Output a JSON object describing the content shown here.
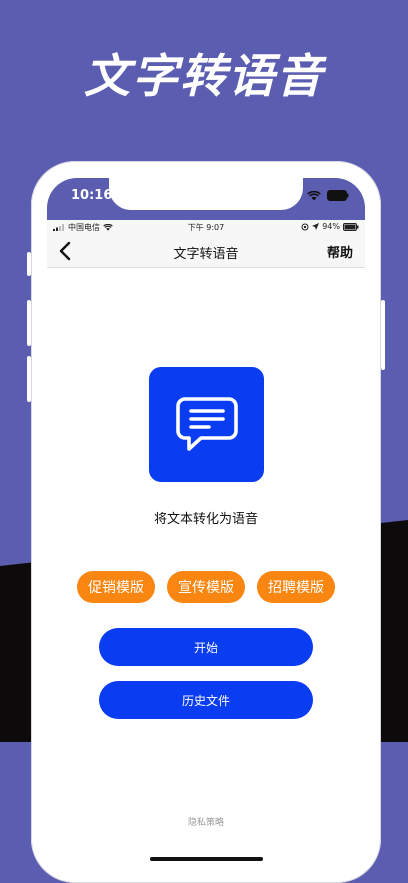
{
  "colors": {
    "background": "#5b5db0",
    "dark_band": "#0d0a0c",
    "accent_blue": "#0a3cf2",
    "template_orange": "#f98610"
  },
  "headline": "文字转语音",
  "outer_status": {
    "time": "10:16"
  },
  "inner_status": {
    "carrier": "中国电信",
    "time": "下午 9:07",
    "battery": "94%"
  },
  "navbar": {
    "back_icon": "chevron-left-icon",
    "title": "文字转语音",
    "help": "帮助"
  },
  "main": {
    "icon": "message-bubble-icon",
    "description": "将文本转化为语音",
    "templates": [
      {
        "label": "促销模版"
      },
      {
        "label": "宣传模版"
      },
      {
        "label": "招聘模版"
      }
    ],
    "start_label": "开始",
    "history_label": "历史文件",
    "privacy_label": "隐私策略"
  }
}
